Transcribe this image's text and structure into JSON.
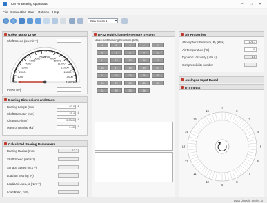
{
  "app": {
    "title": "TCM Air Bearing Apparatus"
  },
  "menu": [
    "File",
    "Connection",
    "Data",
    "Options",
    "Help"
  ],
  "toolbar": {
    "series_value": "Data Series 1"
  },
  "motor": {
    "title": "6.0kW Motor Drive",
    "shaft_speed_label": "Shaft Speed (rev.min⁻¹)",
    "gauge_ticks": [
      "0",
      "1000",
      "2000",
      "3000",
      "4000",
      "5000",
      "6000",
      "7000",
      "8000",
      "9000",
      "10000",
      "11000",
      "12000",
      "13000",
      "14000",
      "15000"
    ],
    "gauge_value": 0,
    "power_label": "Power (W)"
  },
  "bearing_dims": {
    "title": "Bearing Dimensions and Mass",
    "rows": [
      {
        "label": "Bearing Length (mm)",
        "value": "50.0"
      },
      {
        "label": "Shaft Diameter (mm)",
        "value": "25.4"
      },
      {
        "label": "Clearance (mm)",
        "value": "0.0300"
      },
      {
        "label": "Mass of Bearing (kg)",
        "value": "2.00"
      }
    ]
  },
  "calc_params": {
    "title": "Calculated Bearing Parameters",
    "rows": [
      {
        "label": "Bearing Radius (mm)",
        "value": "12.7"
      },
      {
        "label": "Shaft Speed (rad.s⁻¹)",
        "value": ""
      },
      {
        "label": "Surface Speed (m.s⁻¹)",
        "value": ""
      },
      {
        "label": "Load on Bearing (N)",
        "value": ""
      },
      {
        "label": "Load/Unit Area, σ (N.m⁻²)",
        "value": ""
      },
      {
        "label": "Load Ratio, σ/P₀",
        "value": ""
      }
    ]
  },
  "dp32": {
    "title": "DP32 Multi-Channel Pressure System",
    "measured_label": "Measured Bearing Pressure (kPa)",
    "channels": [
      "1",
      "2",
      "3",
      "4",
      "5",
      "6",
      "7",
      "8",
      "9",
      "10",
      "11",
      "12",
      "13",
      "14",
      "15",
      "16",
      "17",
      "18",
      "19",
      "20",
      "21",
      "22",
      "23",
      "24",
      "25",
      "26",
      "27",
      "28",
      "29",
      "30",
      "31",
      "32",
      "33",
      "34"
    ]
  },
  "air": {
    "title": "Air Properties",
    "rows": [
      {
        "label": "Atmospheric Pressure, P₀ (kPa)",
        "value": "101.3"
      },
      {
        "label": "Air Temperature (°C)",
        "value": "20"
      },
      {
        "label": "Dynamic Viscosity (μPa.s)",
        "value": "1.8"
      },
      {
        "label": "Compressibility number",
        "value": ""
      }
    ]
  },
  "analogue": {
    "title": "Analogue Input Board"
  },
  "dti": {
    "title": "DTI Inputs",
    "positions": [
      "1",
      "2",
      "3",
      "4",
      "5",
      "6",
      "7",
      "8",
      "9",
      "10",
      "11",
      "12",
      "13",
      "14",
      "15",
      "16"
    ]
  },
  "status": {
    "text": "Data Lines in Series: 0"
  },
  "colors": {
    "panel_icon": "#c0392b",
    "cell": "#9a9a9a",
    "needle": "#c0392b"
  }
}
